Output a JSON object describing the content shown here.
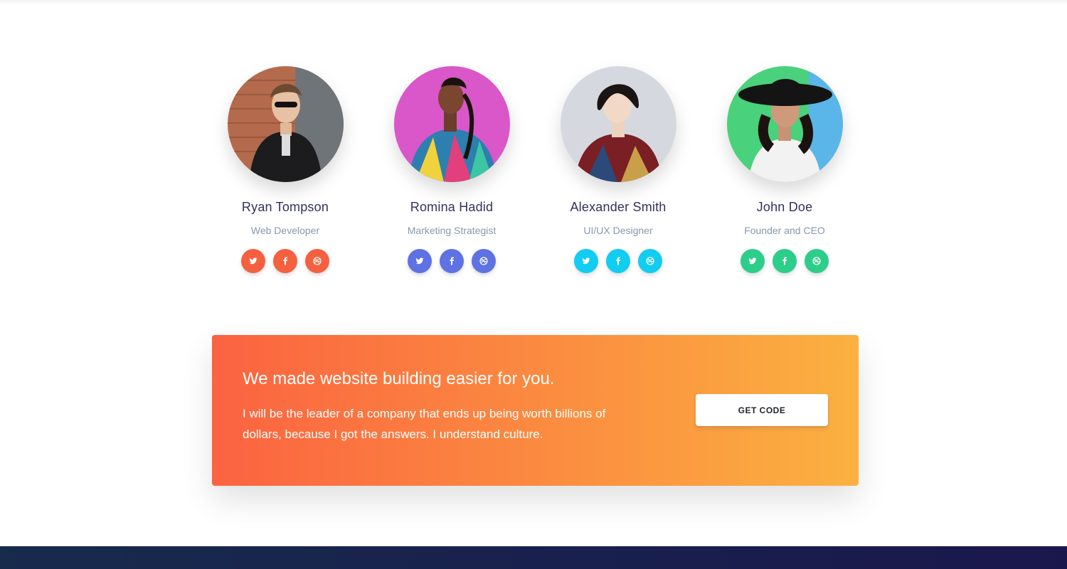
{
  "team": [
    {
      "name": "Ryan Tompson",
      "role": "Web Developer",
      "accent": "#f5613f",
      "socials": [
        "twitter-icon",
        "facebook-icon",
        "dribbble-icon"
      ]
    },
    {
      "name": "Romina Hadid",
      "role": "Marketing Strategist",
      "accent": "#5e72e4",
      "socials": [
        "twitter-icon",
        "facebook-icon",
        "dribbble-icon"
      ]
    },
    {
      "name": "Alexander Smith",
      "role": "UI/UX Designer",
      "accent": "#11cdef",
      "socials": [
        "twitter-icon",
        "facebook-icon",
        "dribbble-icon"
      ]
    },
    {
      "name": "John Doe",
      "role": "Founder and CEO",
      "accent": "#2dce89",
      "socials": [
        "twitter-icon",
        "facebook-icon",
        "dribbble-icon"
      ]
    }
  ],
  "cta": {
    "title": "We made website building easier for you.",
    "text": "I will be the leader of a company that ends up being worth billions of dollars, because I got the answers. I understand culture.",
    "button_label": "GET CODE",
    "gradient_start": "#fb6340",
    "gradient_end": "#fbb140"
  },
  "footer": {
    "color": "#172b4d"
  }
}
